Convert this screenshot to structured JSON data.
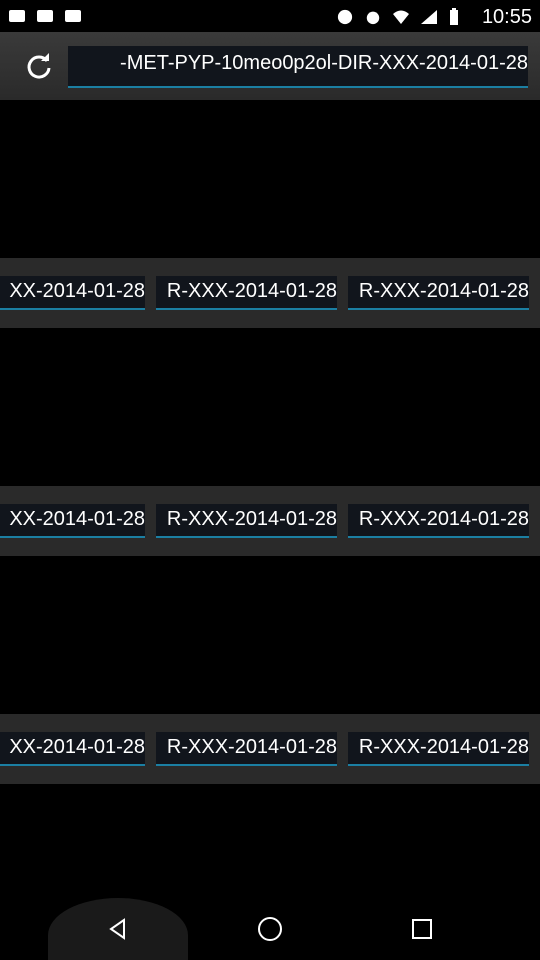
{
  "status_bar": {
    "time": "10:55"
  },
  "toolbar": {
    "refresh_icon": "refresh-icon",
    "url_text": "-MET-PYP-10meo0p2ol-DIR-XXX-2014-01-28"
  },
  "grid": {
    "rows": [
      {
        "cells": [
          "XX-2014-01-28",
          "R-XXX-2014-01-28",
          "R-XXX-2014-01-28"
        ]
      },
      {
        "cells": [
          "XX-2014-01-28",
          "R-XXX-2014-01-28",
          "R-XXX-2014-01-28"
        ]
      },
      {
        "cells": [
          "XX-2014-01-28",
          "R-XXX-2014-01-28",
          "R-XXX-2014-01-28"
        ]
      }
    ]
  },
  "nav": {
    "back": "back-icon",
    "home": "home-icon",
    "recents": "recents-icon"
  },
  "colors": {
    "accent": "#1b7fa3",
    "bar": "#2a2a2a"
  }
}
